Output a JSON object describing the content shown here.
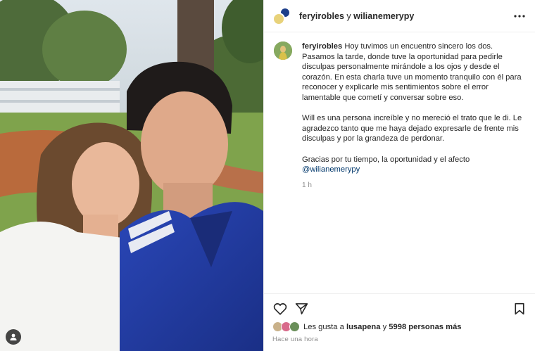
{
  "header": {
    "author": "feryirobles",
    "connector": "y",
    "collaborator": "wilianemerypy",
    "more_icon": "more-horizontal-icon"
  },
  "caption": {
    "username": "feryirobles",
    "paragraph1": "Hoy tuvimos un encuentro sincero los dos. Pasamos la tarde, donde tuve la oportunidad para pedirle disculpas personalmente mirándole a los ojos y desde el corazón. En esta charla tuve un momento tranquilo con él para reconocer y explicarle mis sentimientos sobre el error lamentable que cometí y conversar sobre eso.",
    "paragraph2": "Will es una persona increíble y no mereció el trato que le di. Le agradezco tanto que me haya dejado expresarle de frente mis disculpas y por la grandeza de perdonar.",
    "paragraph3": "Gracias por tu tiempo, la oportunidad y el afecto",
    "mention": "@wilianemerypy",
    "time": "1 h"
  },
  "actions": {
    "like_icon": "heart-icon",
    "share_icon": "send-icon",
    "save_icon": "bookmark-icon"
  },
  "likes": {
    "prefix": "Les gusta a",
    "user": "lusapena",
    "connector": "y",
    "others": "5998 personas más"
  },
  "post_time": "Hace una hora",
  "photo": {
    "tag_icon": "user-tag-icon"
  }
}
